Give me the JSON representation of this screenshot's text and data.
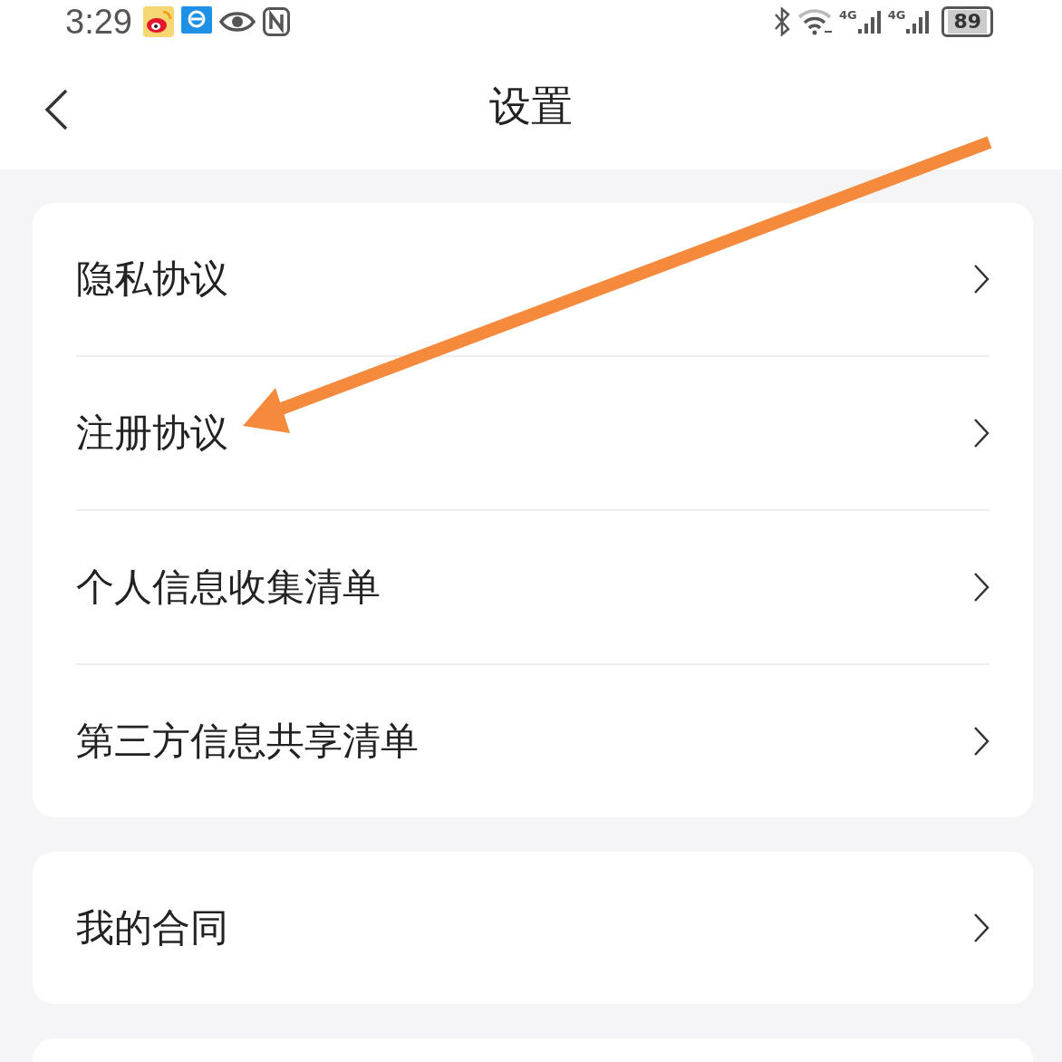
{
  "status_bar": {
    "time": "3:29",
    "network_labels": [
      "4G",
      "4G"
    ],
    "battery": "89"
  },
  "header": {
    "title": "设置"
  },
  "groups": [
    {
      "kind": "list",
      "items": [
        {
          "label": "隐私协议"
        },
        {
          "label": "注册协议"
        },
        {
          "label": "个人信息收集清单"
        },
        {
          "label": "第三方信息共享清单"
        }
      ]
    },
    {
      "kind": "list",
      "items": [
        {
          "label": "我的合同"
        }
      ]
    },
    {
      "kind": "blank"
    }
  ],
  "annotation": {
    "kind": "arrow"
  }
}
